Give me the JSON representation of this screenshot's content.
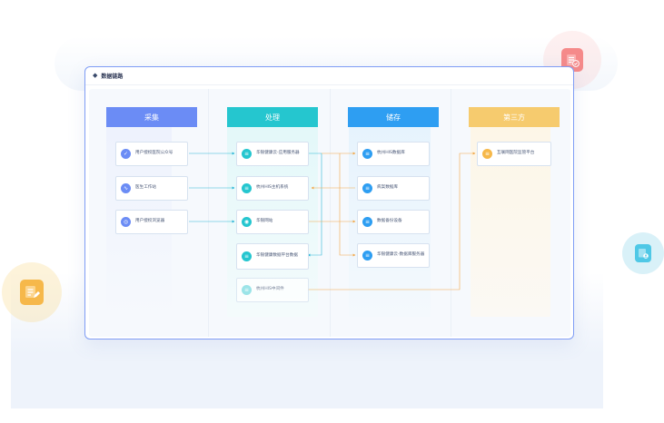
{
  "window": {
    "title": "数据链路"
  },
  "lanes": [
    {
      "key": "collect",
      "label": "采集",
      "color": "#6b8cf5"
    },
    {
      "key": "process",
      "label": "处理",
      "color": "#25c6cf"
    },
    {
      "key": "store",
      "label": "储存",
      "color": "#2e9ef2"
    },
    {
      "key": "third",
      "label": "第三方",
      "color": "#f6cb6e"
    }
  ],
  "nodes": {
    "c1": "用户授权医院公众号",
    "c2": "医生工作站",
    "c3": "用户授权浏览器",
    "p1": "华银健康云-应用服务器",
    "p2": "杭州HIS主机系统",
    "p3": "华银网站",
    "p4": "华银健康数据平台数据",
    "p5": "杭州HIS中间件",
    "s1": "杭州HIS数据库",
    "s2": "病案数据库",
    "s3": "数据备份设备",
    "s4": "华银健康云-数据库服务器",
    "t1": "互联网医院监管平台"
  },
  "icons": {
    "c1": "shield-icon",
    "c2": "stethoscope-icon",
    "c3": "browser-icon",
    "p1": "server-icon",
    "p2": "server-icon",
    "p3": "globe-icon",
    "p4": "server-icon",
    "p5": "server-icon",
    "s1": "database-icon",
    "s2": "database-icon",
    "s3": "database-icon",
    "s4": "database-icon",
    "t1": "database-icon"
  },
  "colors": {
    "window_border": "#7f9df5",
    "link_blue": "#2cb6d6",
    "link_orange": "#f2a84a",
    "icon_collect": "#6b8cf5",
    "icon_process": "#25c6cf",
    "icon_store": "#2e9ef2",
    "icon_third": "#f6b84a",
    "badge_red": "#f58a8a",
    "badge_orange": "#f6b84a",
    "badge_teal": "#4fc8e6"
  }
}
